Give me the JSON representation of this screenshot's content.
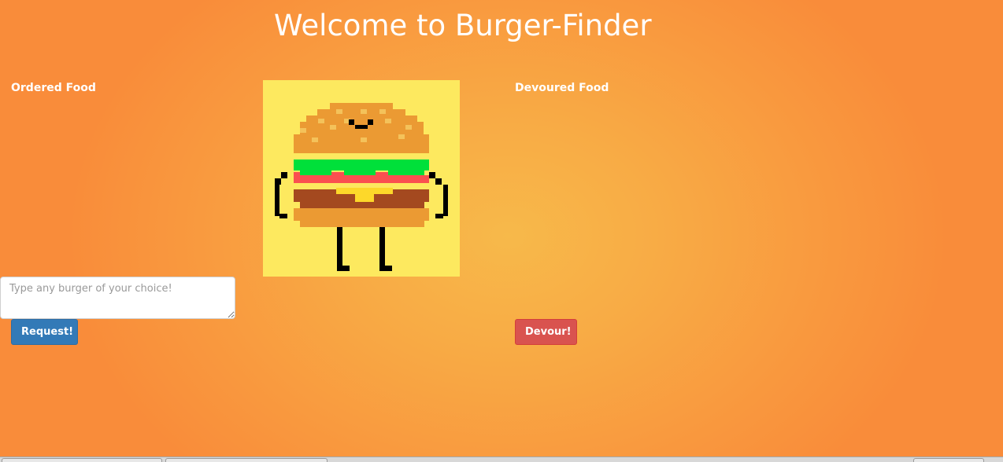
{
  "page": {
    "title": "Welcome to Burger-Finder"
  },
  "ordered": {
    "label": "Ordered Food"
  },
  "devoured": {
    "label": "Devoured Food"
  },
  "burger_input": {
    "placeholder": "Type any burger of your choice!",
    "value": ""
  },
  "buttons": {
    "request_label": "Request!",
    "devour_label": "Devour!"
  },
  "colors": {
    "background_center": "#f7b94a",
    "background_edge": "#f98c3a",
    "request_button": "#337ab7",
    "devour_button": "#d9534f",
    "art_background": "#fde95f"
  },
  "icons": {
    "burger_art": "pixel-burger-character"
  }
}
